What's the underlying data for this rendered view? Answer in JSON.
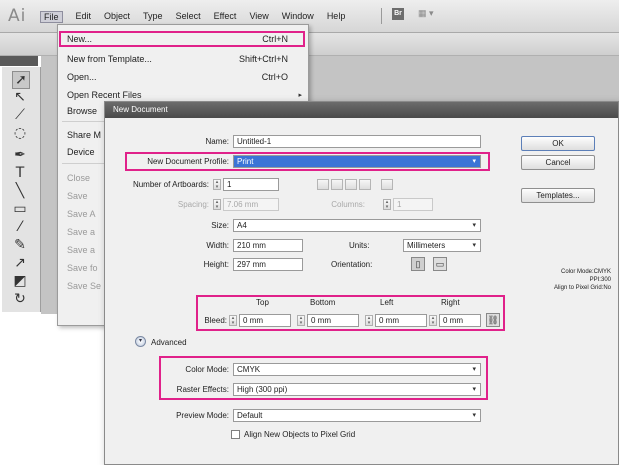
{
  "app": {
    "logo": "Ai",
    "menus": [
      "File",
      "Edit",
      "Object",
      "Type",
      "Select",
      "Effect",
      "View",
      "Window",
      "Help"
    ],
    "bridge_icon": "Br",
    "workspace_icon": "▦ ▾"
  },
  "file_menu": {
    "items": [
      {
        "label": "New...",
        "shortcut": "Ctrl+N",
        "disabled": false
      },
      {
        "label": "New from Template...",
        "shortcut": "Shift+Ctrl+N",
        "disabled": false
      },
      {
        "label": "Open...",
        "shortcut": "Ctrl+O",
        "disabled": false
      },
      {
        "label": "Open Recent Files",
        "shortcut": "",
        "disabled": false
      },
      {
        "label": "Browse",
        "shortcut": "",
        "disabled": false
      },
      {
        "label": "Share M",
        "shortcut": "",
        "disabled": false
      },
      {
        "label": "Device",
        "shortcut": "",
        "disabled": false
      },
      {
        "label": "Close",
        "shortcut": "",
        "disabled": true
      },
      {
        "label": "Save",
        "shortcut": "",
        "disabled": true
      },
      {
        "label": "Save A",
        "shortcut": "",
        "disabled": true
      },
      {
        "label": "Save a",
        "shortcut": "",
        "disabled": true
      },
      {
        "label": "Save a",
        "shortcut": "",
        "disabled": true
      },
      {
        "label": "Save fo",
        "shortcut": "",
        "disabled": true
      },
      {
        "label": "Save Se",
        "shortcut": "",
        "disabled": true
      }
    ]
  },
  "dialog": {
    "title": "New Document",
    "name_label": "Name:",
    "name_value": "Untitled-1",
    "profile_label": "New Document Profile:",
    "profile_value": "Print",
    "artboards_label": "Number of Artboards:",
    "artboards_value": "1",
    "spacing_label": "Spacing:",
    "spacing_value": "7.06 mm",
    "columns_label": "Columns:",
    "columns_value": "1",
    "size_label": "Size:",
    "size_value": "A4",
    "width_label": "Width:",
    "width_value": "210 mm",
    "units_label": "Units:",
    "units_value": "Millimeters",
    "height_label": "Height:",
    "height_value": "297 mm",
    "orientation_label": "Orientation:",
    "bleed": {
      "label": "Bleed:",
      "top_label": "Top",
      "top_value": "0 mm",
      "bottom_label": "Bottom",
      "bottom_value": "0 mm",
      "left_label": "Left",
      "left_value": "0 mm",
      "right_label": "Right",
      "right_value": "0 mm"
    },
    "advanced_label": "Advanced",
    "color_mode_label": "Color Mode:",
    "color_mode_value": "CMYK",
    "raster_label": "Raster Effects:",
    "raster_value": "High (300 ppi)",
    "preview_label": "Preview Mode:",
    "preview_value": "Default",
    "align_label": "Align New Objects to Pixel Grid",
    "buttons": {
      "ok": "OK",
      "cancel": "Cancel",
      "templates": "Templates..."
    },
    "info": [
      "Color Mode:CMYK",
      "PPI:300",
      "Align to Pixel Grid:No"
    ]
  },
  "colors": {
    "highlight": "#e0218a",
    "selection": "#3b74d6"
  }
}
